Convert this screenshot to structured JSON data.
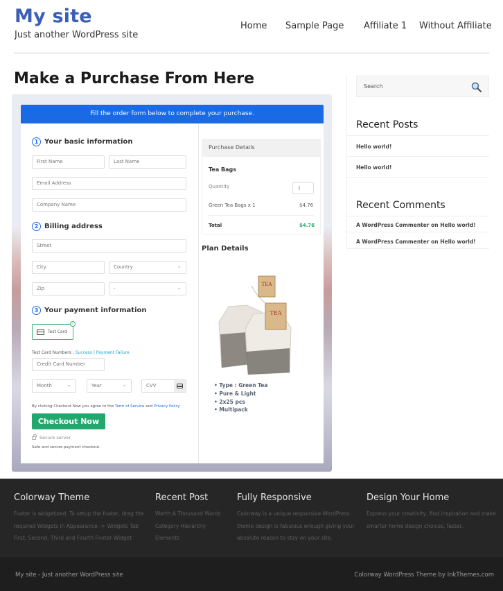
{
  "header": {
    "site_title": "My site",
    "tagline": "Just another WordPress site",
    "nav": [
      "Home",
      "Sample Page",
      "Affiliate 1",
      "Without Affiliate"
    ]
  },
  "page": {
    "title": "Make a Purchase From Here"
  },
  "form": {
    "banner": "Fill the order form below to complete your purchase.",
    "section1": {
      "number": "1",
      "title": "Your basic information"
    },
    "first_name_placeholder": "First Name",
    "last_name_placeholder": "Last Name",
    "email_placeholder": "Email Address",
    "company_placeholder": "Company Name",
    "section2": {
      "number": "2",
      "title": "Billing address"
    },
    "street_placeholder": "Street",
    "city_placeholder": "City",
    "country_selected": "Country",
    "zip_placeholder": "Zip",
    "state_selected": "-",
    "section3": {
      "number": "3",
      "title": "Your payment information"
    },
    "payment_method": "Test Card",
    "test_card_label": "Test Card Numbers :",
    "test_success": "Success",
    "test_separator": "|",
    "test_failure": "Payment Failure",
    "card_number_placeholder": "Credit Card Number",
    "month_selected": "Month",
    "year_selected": "Year",
    "cvv_placeholder": "CVV",
    "agree_prefix": "By clicking Checkout Now you agree to the",
    "terms_link": "Term of Service",
    "agree_and": "and",
    "privacy_link": "Privacy Policy",
    "checkout_button": "Checkout Now",
    "secure_server": "Secure server",
    "secure_note": "Safe and secure payment checkout."
  },
  "purchase": {
    "header": "Purchase Details",
    "product": "Tea Bags",
    "quantity_label": "Quantity",
    "quantity_value": "1",
    "line_item": "Green Tea Bags x 1",
    "line_price": "$4.76",
    "total_label": "Total",
    "total_value": "$4.76",
    "total_color": "#22a86e"
  },
  "plan": {
    "title": "Plan Details",
    "features": [
      "Type : Green Tea",
      "Pure & Light",
      "2x25 pcs",
      "Multipack"
    ],
    "tag_text": "TEA"
  },
  "sidebar": {
    "search_placeholder": "Search",
    "recent_posts_title": "Recent Posts",
    "recent_posts": [
      "Hello world!",
      "Hello world!"
    ],
    "recent_comments_title": "Recent Comments",
    "recent_comments": [
      "A WordPress Commenter on Hello world!",
      "A WordPress Commenter on Hello world!"
    ]
  },
  "footer": {
    "col1": {
      "title": "Colorway Theme",
      "lines": [
        "Footer is widgetized. To setup the footer, drag the",
        "required Widgets in Appearance -> Widgets Tab",
        "First, Second, Third and Fourth Footer Widget"
      ]
    },
    "col2": {
      "title": "Recent Post",
      "lines": [
        "Worth A Thousand Words",
        "Category Hierarchy",
        "Elements"
      ]
    },
    "col3": {
      "title": "Fully Responsive",
      "lines": [
        "Colorway is a unique responsive WordPress",
        "theme design is fabulous enough giving your",
        "absolute reason to stay on your site."
      ]
    },
    "col4": {
      "title": "Design Your Home",
      "lines": [
        "Express your creativity, find inspiration and make",
        "smarter home design choices, faster."
      ]
    },
    "bottom_left": "My site - Just another WordPress site",
    "bottom_right": "Colorway WordPress Theme by InkThemes.com"
  },
  "colors": {
    "brand_blue": "#3b5fb4",
    "banner_blue": "#1a6ae6",
    "checkout_green": "#22a86e"
  }
}
